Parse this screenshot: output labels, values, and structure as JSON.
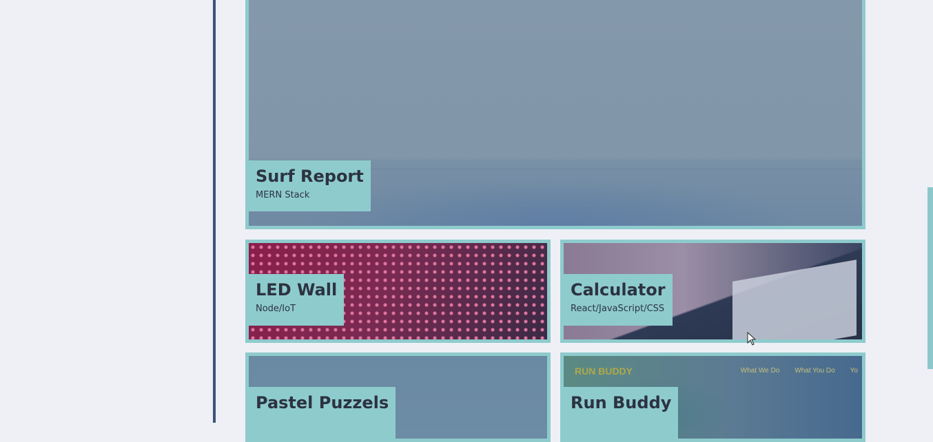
{
  "projects": [
    {
      "id": "surf",
      "title": "Surf Report",
      "stack": "MERN Stack"
    },
    {
      "id": "led",
      "title": "LED Wall",
      "stack": "Node/IoT"
    },
    {
      "id": "calc",
      "title": "Calculator",
      "stack": "React/JavaScript/CSS"
    },
    {
      "id": "pastel",
      "title": "Pastel Puzzels",
      "stack": ""
    },
    {
      "id": "run",
      "title": "Run Buddy",
      "stack": ""
    }
  ],
  "run_buddy_preview": {
    "brand": "RUN BUDDY",
    "nav": [
      "What We Do",
      "What You Do",
      "Yo"
    ]
  },
  "colors": {
    "card_border": "#8ecbcd",
    "caption_text": "#2c3340",
    "left_rule": "#3d5478",
    "page_bg": "#eef0f6"
  }
}
